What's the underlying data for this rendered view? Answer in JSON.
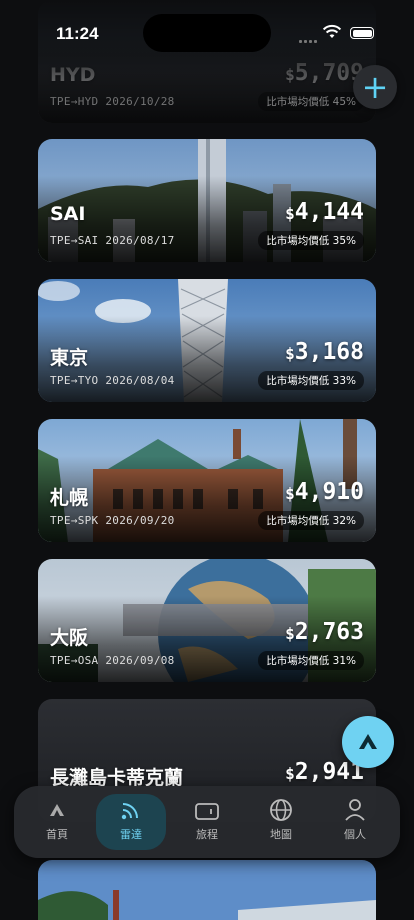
{
  "status": {
    "time": "11:24"
  },
  "cards": [
    {
      "city": "HYD",
      "route": "TPE→HYD 2026/10/28",
      "currency": "$",
      "price": "5,709",
      "badge": "比市場均價低 45%"
    },
    {
      "city": "SAI",
      "route": "TPE→SAI 2026/08/17",
      "currency": "$",
      "price": "4,144",
      "badge": "比市場均價低 35%"
    },
    {
      "city": "東京",
      "route": "TPE→TYO 2026/08/04",
      "currency": "$",
      "price": "3,168",
      "badge": "比市場均價低 33%"
    },
    {
      "city": "札幌",
      "route": "TPE→SPK 2026/09/20",
      "currency": "$",
      "price": "4,910",
      "badge": "比市場均價低 32%"
    },
    {
      "city": "大阪",
      "route": "TPE→OSA 2026/09/08",
      "currency": "$",
      "price": "2,763",
      "badge": "比市場均價低 31%"
    },
    {
      "city": "長灘島卡蒂克蘭",
      "currency": "$",
      "price": "2,941"
    }
  ],
  "tabs": [
    {
      "label": "首頁",
      "icon": "home-icon"
    },
    {
      "label": "雷達",
      "icon": "radar-icon"
    },
    {
      "label": "旅程",
      "icon": "ticket-icon"
    },
    {
      "label": "地圖",
      "icon": "globe-icon"
    },
    {
      "label": "個人",
      "icon": "person-icon"
    }
  ],
  "colors": {
    "accent": "#6fd2f2",
    "background": "#0d0e10",
    "tab_active_bg": "#1d4450"
  }
}
